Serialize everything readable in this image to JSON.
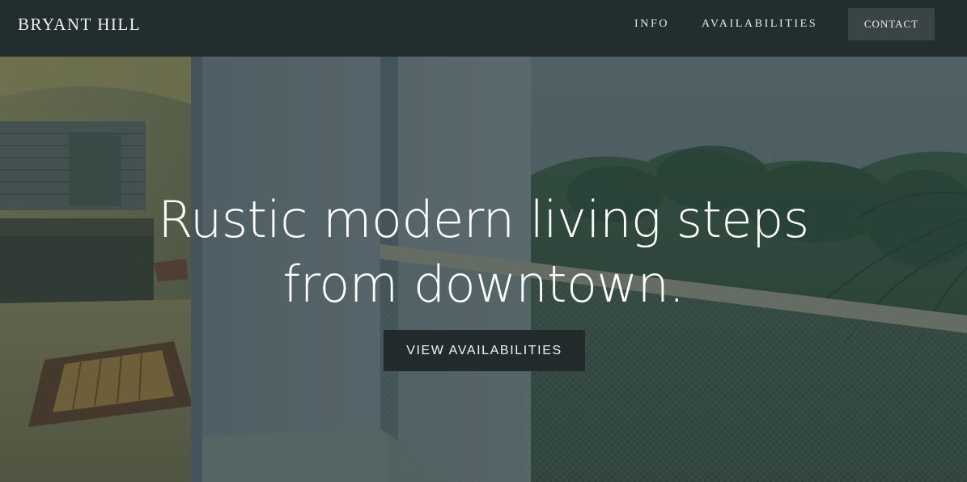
{
  "header": {
    "brand": "BRYANT HILL",
    "nav": {
      "info": "INFO",
      "availabilities": "AVAILABILITIES",
      "contact": "CONTACT"
    }
  },
  "hero": {
    "title_line1": "Rustic modern living steps",
    "title_line2": "from downtown.",
    "cta_label": "VIEW AVAILABILITIES"
  },
  "colors": {
    "header_bg": "#222d2e",
    "contact_bg": "#3a4446",
    "cta_bg": "#222b2c",
    "text": "#ffffff"
  }
}
